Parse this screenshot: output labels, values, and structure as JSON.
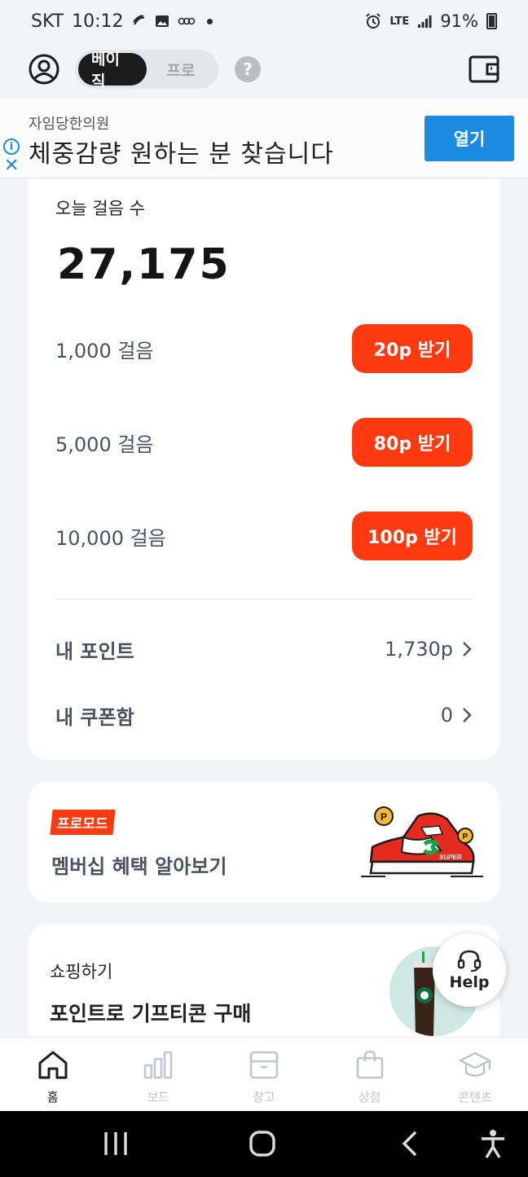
{
  "status_bar": {
    "carrier": "SKT",
    "time": "10:12",
    "network": "LTE",
    "battery": "91%"
  },
  "header": {
    "mode_basic": "베이직",
    "mode_pro": "프로",
    "help_symbol": "?"
  },
  "ad": {
    "advertiser": "자임당한의원",
    "headline": "체중감량 원하는 분 찾습니다",
    "cta": "열기",
    "info_symbol": "i",
    "close_symbol": "✕"
  },
  "steps": {
    "label": "오늘 걸음 수",
    "count": "27,175",
    "rewards": [
      {
        "label": "1,000 걸음",
        "button": "20p 받기"
      },
      {
        "label": "5,000 걸음",
        "button": "80p 받기"
      },
      {
        "label": "10,000 걸음",
        "button": "100p 받기"
      }
    ],
    "my_points_label": "내 포인트",
    "my_points_value": "1,730p",
    "my_coupons_label": "내 쿠폰함",
    "my_coupons_value": "0"
  },
  "promo": {
    "badge": "프로모드",
    "title": "멤버십 혜택 알아보기",
    "illustration_text": "SUPER"
  },
  "shop": {
    "label": "쇼핑하기",
    "title": "포인트로 기프티콘 구매"
  },
  "help_fab": {
    "label": "Help"
  },
  "bottom_nav": {
    "items": [
      {
        "label": "홈",
        "icon": "home-icon"
      },
      {
        "label": "보드",
        "icon": "bar-chart-icon"
      },
      {
        "label": "창고",
        "icon": "box-icon"
      },
      {
        "label": "상점",
        "icon": "shopping-bag-icon"
      },
      {
        "label": "콘텐츠",
        "icon": "graduation-cap-icon"
      }
    ]
  },
  "colors": {
    "accent": "#ff3a10",
    "ad_blue": "#1a8be0",
    "text_muted": "#4a5260",
    "background": "#f3f4f6"
  }
}
